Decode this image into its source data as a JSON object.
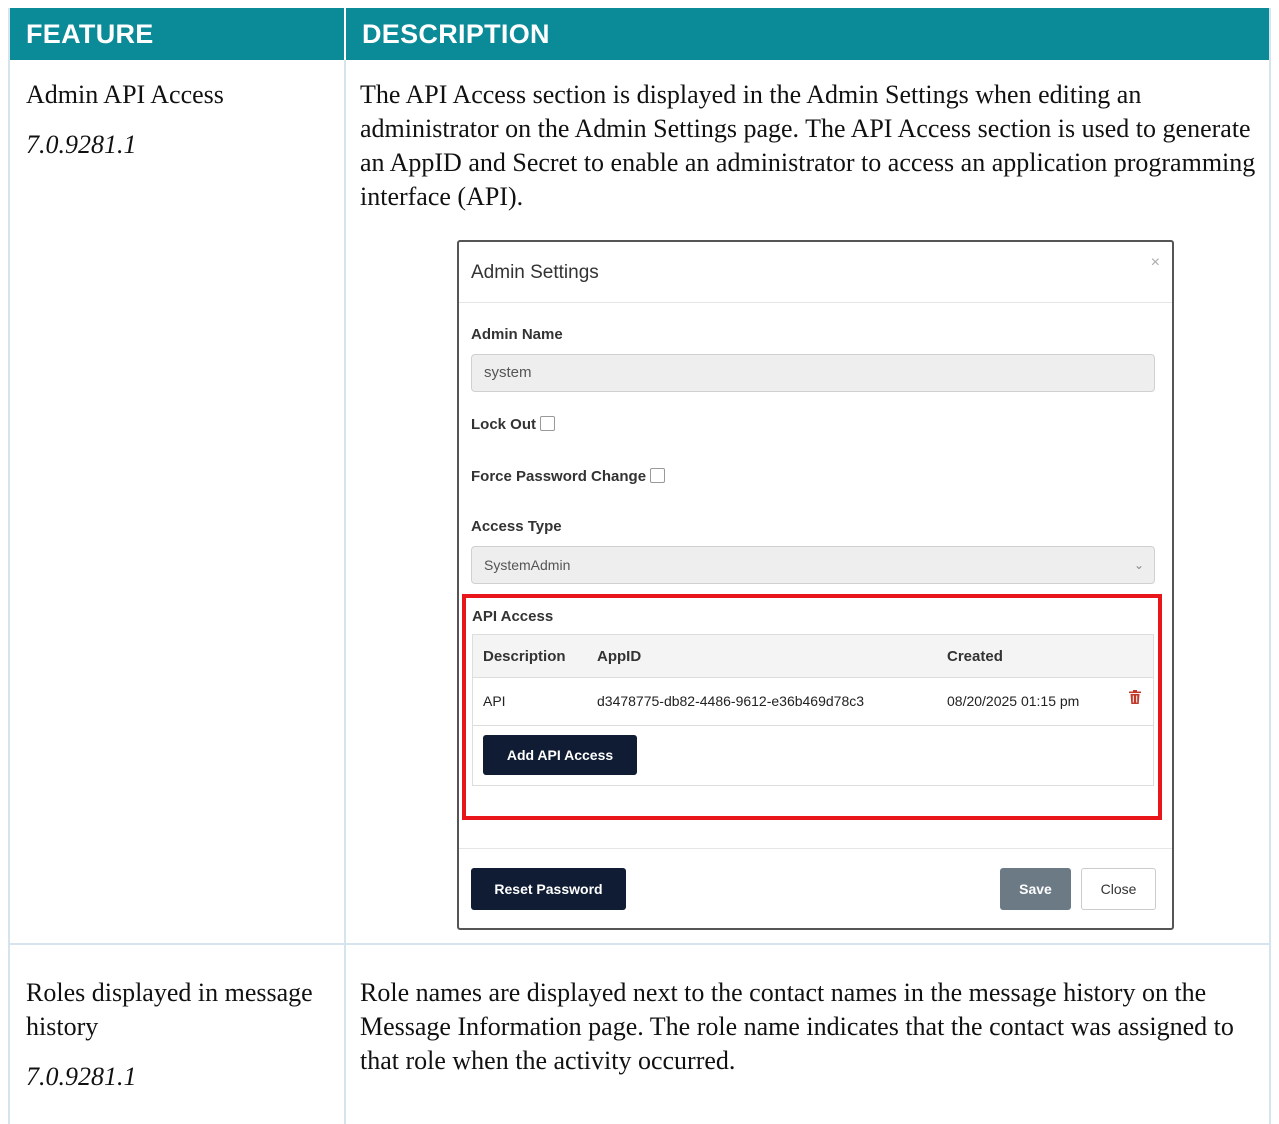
{
  "header": {
    "feature": "FEATURE",
    "description": "DESCRIPTION"
  },
  "rows": [
    {
      "feature": "Admin API Access",
      "version": "7.0.9281.1",
      "description": "The API Access section is displayed in the Admin Settings when editing an administrator on the Admin Settings page. The API Access section is used to generate an AppID and Secret to enable an administrator to access an application programming interface (API)."
    },
    {
      "feature": "Roles displayed in message history",
      "version": "7.0.9281.1",
      "description": "Role names are displayed next to the contact names in the message history on the Message Information page. The role name indicates that the contact was assigned to that role when the activity occurred."
    }
  ],
  "dialog": {
    "title": "Admin Settings",
    "close_glyph": "×",
    "admin_name_label": "Admin Name",
    "admin_name_value": "system",
    "lock_out_label": "Lock Out",
    "force_password_label": "Force Password Change",
    "access_type_label": "Access Type",
    "access_type_value": "SystemAdmin",
    "api_access": {
      "title": "API Access",
      "columns": [
        "Description",
        "AppID",
        "Created"
      ],
      "rows": [
        {
          "description": "API",
          "appid": "d3478775-db82-4486-9612-e36b469d78c3",
          "created": "08/20/2025 01:15 pm"
        }
      ],
      "add_button": "Add API Access"
    },
    "reset_password_button": "Reset Password",
    "save_button": "Save",
    "close_button": "Close"
  },
  "colors": {
    "header_bg": "#0b8a98",
    "highlight_border": "#e8151b",
    "dark_button": "#0f1c33",
    "trash_icon": "#c0392b"
  }
}
